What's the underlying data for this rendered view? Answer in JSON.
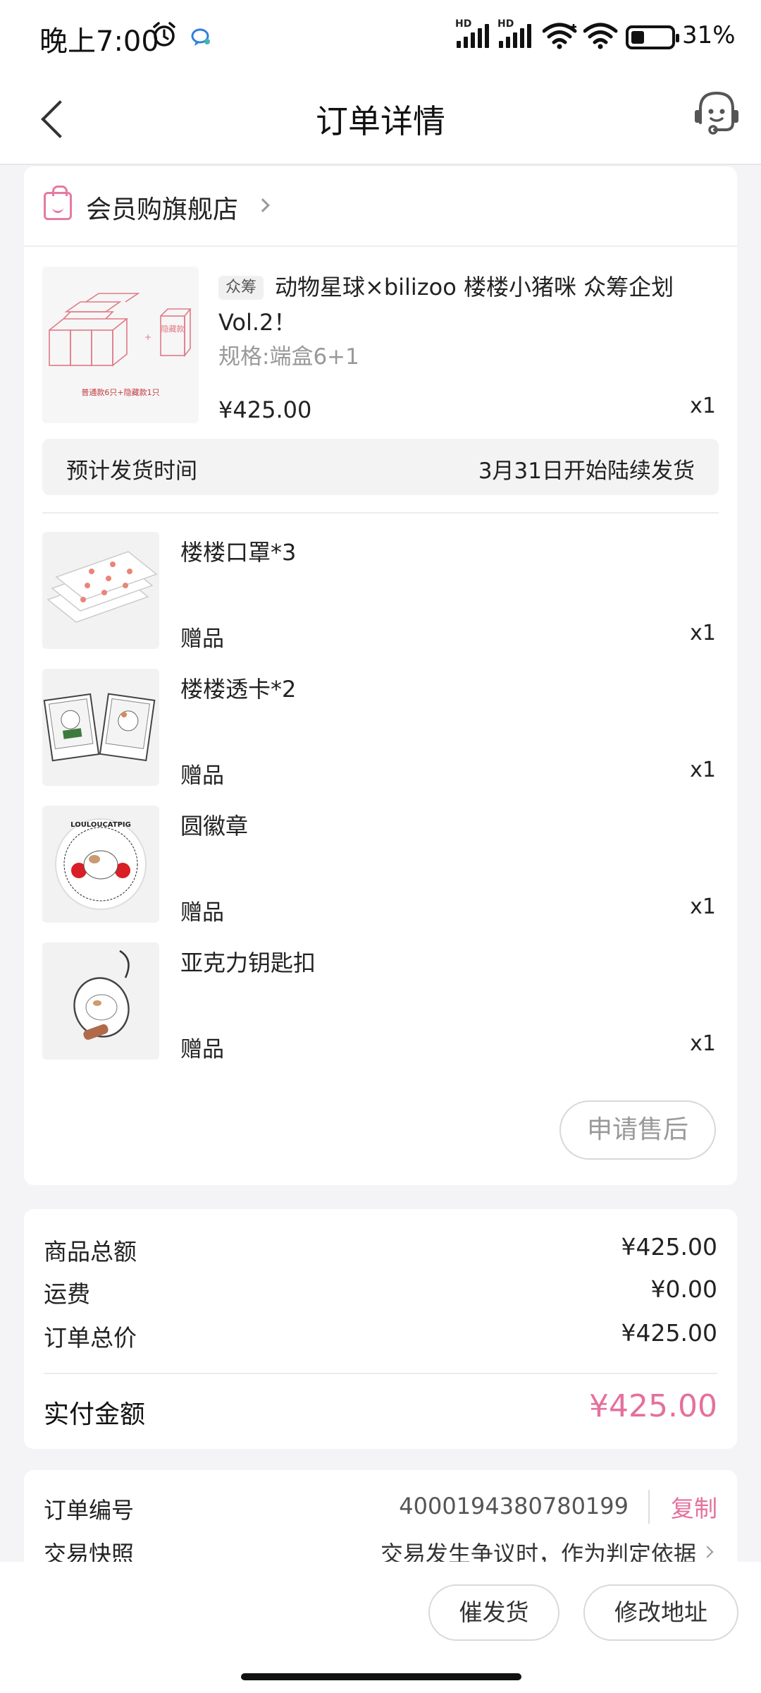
{
  "status_bar": {
    "time": "晚上7:00",
    "battery_percent": "31%",
    "signal_label": "HD"
  },
  "nav": {
    "title": "订单详情",
    "back_icon": "chevron-left-icon",
    "service_icon": "customer-service-icon"
  },
  "store": {
    "name": "会员购旗舰店",
    "icon": "shopping-bag-icon"
  },
  "product": {
    "tag": "众筹",
    "title": "动物星球×bilizoo 楼楼小猪咪 众筹企划Vol.2！",
    "spec": "规格:端盒6+1",
    "price": "¥425.00",
    "qty": "x1",
    "thumb_caption": "普通款6只+隐藏款1只",
    "thumb_hidden_label": "隐藏款"
  },
  "shipping": {
    "label": "预计发货时间",
    "value": "3月31日开始陆续发货"
  },
  "gifts": [
    {
      "name": "楼楼口罩*3",
      "tag": "赠品",
      "qty": "x1"
    },
    {
      "name": "楼楼透卡*2",
      "tag": "赠品",
      "qty": "x1"
    },
    {
      "name": "圆徽章",
      "tag": "赠品",
      "qty": "x1"
    },
    {
      "name": "亚克力钥匙扣",
      "tag": "赠品",
      "qty": "x1"
    }
  ],
  "badge_text": "LOULOUCATPIG",
  "aftersale_label": "申请售后",
  "summary": {
    "goods_total_label": "商品总额",
    "goods_total": "¥425.00",
    "shipping_label": "运费",
    "shipping_fee": "¥0.00",
    "order_total_label": "订单总价",
    "order_total": "¥425.00",
    "paid_label": "实付金额",
    "paid": "¥425.00"
  },
  "order_info": {
    "number_label": "订单编号",
    "number": "4000194380780199",
    "copy_label": "复制",
    "snapshot_label": "交易快照",
    "snapshot_value": "交易发生争议时，作为判定依据"
  },
  "bottom_bar": {
    "urge_label": "催发货",
    "edit_address_label": "修改地址"
  },
  "colors": {
    "accent": "#e5709c",
    "background": "#f4f4f6"
  }
}
